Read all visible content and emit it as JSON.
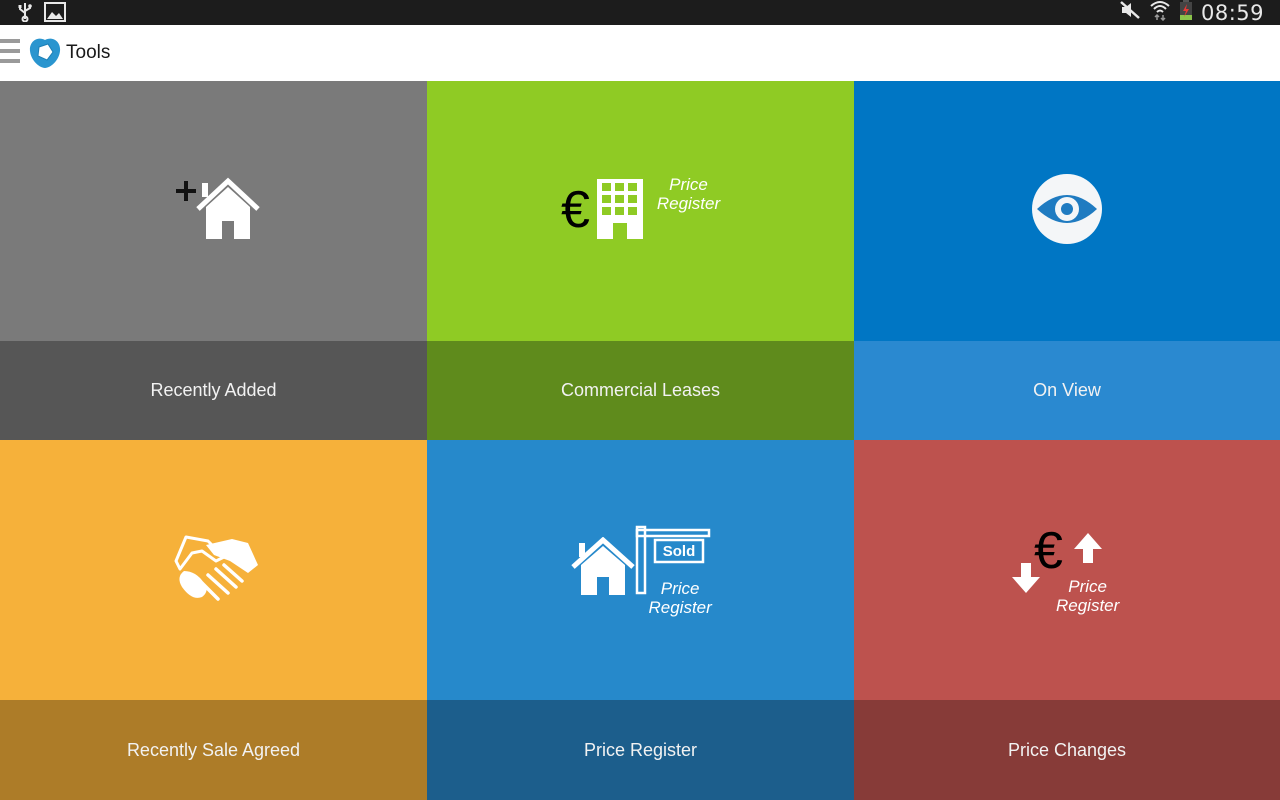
{
  "status_bar": {
    "left_icons": [
      "usb-icon",
      "image-icon"
    ],
    "right_icons": [
      "mute-icon",
      "wifi-icon",
      "battery-icon"
    ],
    "time": "08:59"
  },
  "action_bar": {
    "menu_icon": "hamburger-icon",
    "logo_icon": "app-logo-icon",
    "title": "Tools"
  },
  "tiles": [
    {
      "label": "Recently Added",
      "icon": "add-house-icon",
      "colors": {
        "art": "#7a7a7a",
        "strip": "#565656"
      }
    },
    {
      "label": "Commercial Leases",
      "icon": "euro-building-icon",
      "icon_text": [
        "Price",
        "Register"
      ],
      "colors": {
        "art": "#8fcb24",
        "strip": "#5f8b1c"
      }
    },
    {
      "label": "On View",
      "icon": "eye-icon",
      "colors": {
        "art": "#0076c4",
        "strip": "#2a89d0"
      }
    },
    {
      "label": "Recently Sale Agreed",
      "icon": "handshake-icon",
      "colors": {
        "art": "#f6b13a",
        "strip": "#ad7c28"
      }
    },
    {
      "label": "Price Register",
      "icon": "sold-sign-house-icon",
      "sign_text": "Sold",
      "icon_text": [
        "Price",
        "Register"
      ],
      "colors": {
        "art": "#2689cb",
        "strip": "#1c5e8c"
      }
    },
    {
      "label": "Price Changes",
      "icon": "euro-up-down-icon",
      "icon_text": [
        "Price",
        "Register"
      ],
      "colors": {
        "art": "#bd524e",
        "strip": "#873b38"
      }
    }
  ]
}
